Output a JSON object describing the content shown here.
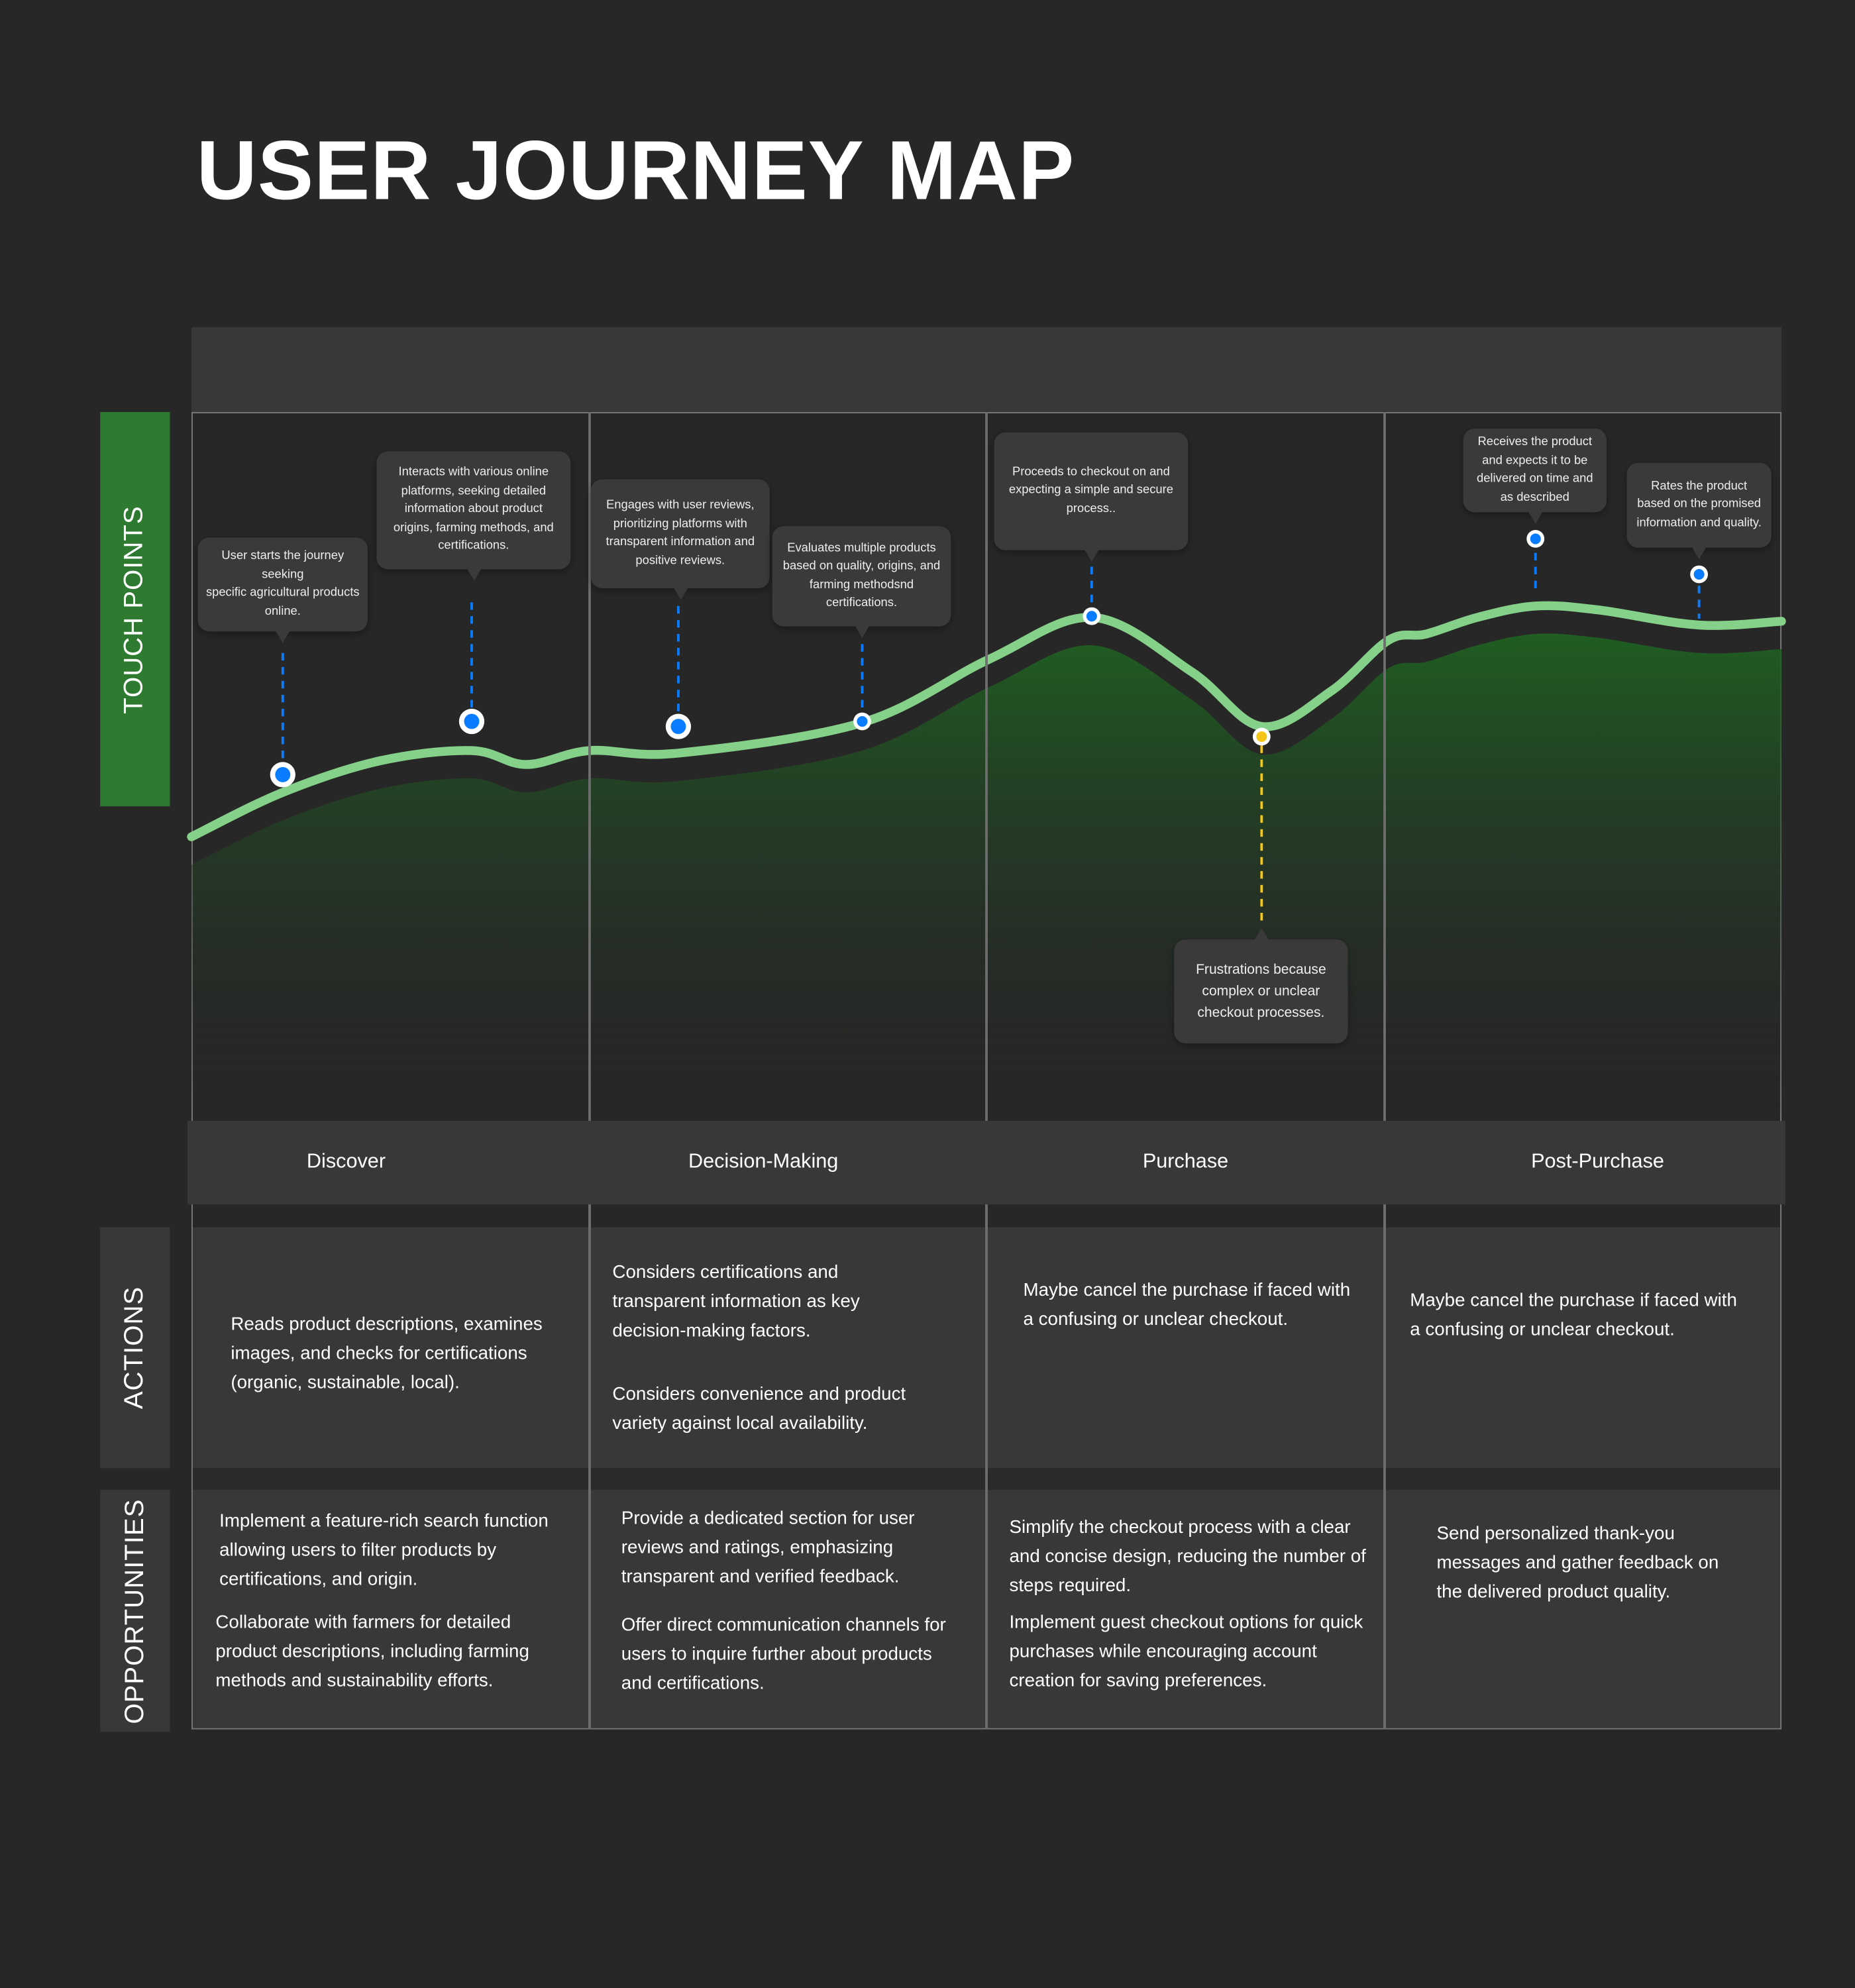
{
  "title": "USER JOURNEY MAP",
  "labels": {
    "touch_points": "TOUCH POINTS",
    "actions": "ACTIONS",
    "opportunities": "OPPORTUNITIES"
  },
  "colors": {
    "background": "#272727",
    "panel": "#383838",
    "label_green": "#2e7a31",
    "curve": "#86d18a",
    "area": "#1f5e22",
    "touch_dot": "#0a7cff",
    "pain_dot": "#f5c518"
  },
  "phases": [
    "Discover",
    "Decision-Making",
    "Purchase",
    "Post-Purchase"
  ],
  "touch_points": [
    {
      "text": "User starts the journey seeking\nspecific agricultural products online.",
      "type": "touch"
    },
    {
      "text": "Interacts with various online platforms, seeking detailed information about product origins, farming methods, and certifications.",
      "type": "touch"
    },
    {
      "text": "Engages with user reviews, prioritizing platforms with transparent information and positive reviews.",
      "type": "touch"
    },
    {
      "text": "Evaluates multiple products based on quality, origins, and farming methodsnd certifications.",
      "type": "touch"
    },
    {
      "text": "Proceeds to checkout on and expecting a simple and secure process..",
      "type": "touch"
    },
    {
      "text": "Frustrations because complex or unclear checkout processes.",
      "type": "pain"
    },
    {
      "text": "Receives the product and expects it to be delivered on time and as described",
      "type": "touch"
    },
    {
      "text": "Rates the product based on the promised information and quality.",
      "type": "touch"
    }
  ],
  "actions": [
    [
      "Reads product descriptions, examines images, and checks for certifications (organic, sustainable, local)."
    ],
    [
      "Considers certifications and transparent information as key decision-making factors.",
      "Considers convenience and product variety against local availability."
    ],
    [
      "Maybe cancel the purchase if faced with a confusing or unclear checkout."
    ],
    [
      "Maybe cancel the purchase if faced with a confusing or unclear checkout."
    ]
  ],
  "opportunities": [
    [
      "Implement a feature-rich search function allowing users to filter products by certifications, and origin.",
      "Collaborate with farmers for detailed product descriptions, including farming methods and sustainability efforts."
    ],
    [
      "Provide a dedicated section for user reviews and ratings, emphasizing transparent and verified feedback.",
      "Offer direct communication channels for users to inquire further about products and certifications."
    ],
    [
      "Simplify the checkout process with a clear and concise design, reducing the number of steps required.",
      "Implement guest checkout options for quick purchases while encouraging account creation for saving preferences."
    ],
    [
      "Send personalized thank-you messages and gather feedback on the delivered product quality."
    ]
  ]
}
